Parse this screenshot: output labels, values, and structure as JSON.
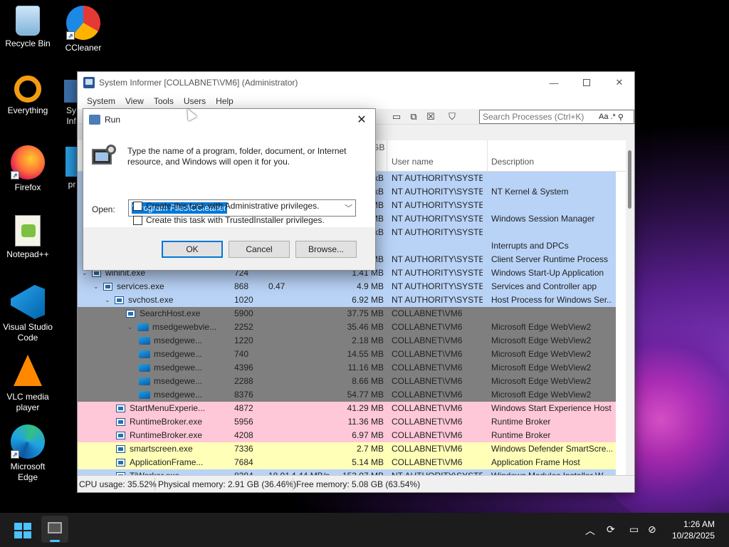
{
  "desktop": {
    "icons": [
      {
        "label": "Recycle Bin",
        "icon": "recycle-bin-icon"
      },
      {
        "label": "CCleaner",
        "icon": "ccleaner-icon"
      },
      {
        "label": "Everything",
        "icon": "everything-icon"
      },
      {
        "label": "Firefox",
        "icon": "firefox-icon"
      },
      {
        "label": "Notepad++",
        "icon": "notepadpp-icon"
      },
      {
        "label": "Visual Studio Code",
        "icon": "vscode-icon"
      },
      {
        "label": "VLC media player",
        "icon": "vlc-icon"
      },
      {
        "label": "Microsoft Edge",
        "icon": "edge-icon"
      }
    ],
    "partial_labels": [
      "Sy",
      "Inf",
      "pr"
    ]
  },
  "si": {
    "title": "System Informer [COLLABNET\\VM6] (Administrator)",
    "menu": [
      "System",
      "View",
      "Tools",
      "Users",
      "Help"
    ],
    "search_placeholder": "Search Processes (Ctrl+K)",
    "search_opts": "Aa",
    "search_regex": ".*",
    "header_partial": "GB",
    "columns": {
      "user": "User name",
      "desc": "Description"
    },
    "rows": [
      {
        "name": "",
        "pid": "",
        "cpu": "",
        "mem": "kB",
        "user": "NT AUTHORITY\\SYSTEM",
        "desc": ""
      },
      {
        "name": "",
        "pid": "",
        "cpu": "",
        "mem": "kB",
        "user": "NT AUTHORITY\\SYSTEM",
        "desc": "NT Kernel & System"
      },
      {
        "name": "",
        "pid": "",
        "cpu": "",
        "mem": "MB",
        "user": "NT AUTHORITY\\SYSTEM",
        "desc": ""
      },
      {
        "name": "",
        "pid": "",
        "cpu": "",
        "mem": "MB",
        "user": "NT AUTHORITY\\SYSTEM",
        "desc": "Windows Session Manager"
      },
      {
        "name": "",
        "pid": "",
        "cpu": "",
        "mem": "kB",
        "user": "NT AUTHORITY\\SYSTEM",
        "desc": ""
      },
      {
        "name": "",
        "pid": "",
        "cpu": "",
        "mem": "",
        "user": "",
        "desc": "Interrupts and DPCs"
      },
      {
        "name": "",
        "pid": "",
        "cpu": "",
        "mem": "MB",
        "user": "NT AUTHORITY\\SYSTEM",
        "desc": "Client Server Runtime Process"
      },
      {
        "name": "wininit.exe",
        "pid": "724",
        "cpu": "",
        "mem": "1.41 MB",
        "user": "NT AUTHORITY\\SYSTEM",
        "desc": "Windows Start-Up Application"
      },
      {
        "name": "services.exe",
        "pid": "868",
        "cpu": "0.47",
        "mem": "4.9 MB",
        "user": "NT AUTHORITY\\SYSTEM",
        "desc": "Services and Controller app"
      },
      {
        "name": "svchost.exe",
        "pid": "1020",
        "cpu": "",
        "mem": "6.92 MB",
        "user": "NT AUTHORITY\\SYSTEM",
        "desc": "Host Process for Windows Ser..."
      },
      {
        "name": "SearchHost.exe",
        "pid": "5900",
        "cpu": "",
        "mem": "37.75 MB",
        "user": "COLLABNET\\VM6",
        "desc": ""
      },
      {
        "name": "msedgewebvie...",
        "pid": "2252",
        "cpu": "",
        "mem": "35.46 MB",
        "user": "COLLABNET\\VM6",
        "desc": "Microsoft Edge WebView2"
      },
      {
        "name": "msedgewe...",
        "pid": "1220",
        "cpu": "",
        "mem": "2.18 MB",
        "user": "COLLABNET\\VM6",
        "desc": "Microsoft Edge WebView2"
      },
      {
        "name": "msedgewe...",
        "pid": "740",
        "cpu": "",
        "mem": "14.55 MB",
        "user": "COLLABNET\\VM6",
        "desc": "Microsoft Edge WebView2"
      },
      {
        "name": "msedgewe...",
        "pid": "4396",
        "cpu": "",
        "mem": "11.16 MB",
        "user": "COLLABNET\\VM6",
        "desc": "Microsoft Edge WebView2"
      },
      {
        "name": "msedgewe...",
        "pid": "2288",
        "cpu": "",
        "mem": "8.66 MB",
        "user": "COLLABNET\\VM6",
        "desc": "Microsoft Edge WebView2"
      },
      {
        "name": "msedgewe...",
        "pid": "8376",
        "cpu": "",
        "mem": "54.77 MB",
        "user": "COLLABNET\\VM6",
        "desc": "Microsoft Edge WebView2"
      },
      {
        "name": "StartMenuExperie...",
        "pid": "4872",
        "cpu": "",
        "mem": "41.29 MB",
        "user": "COLLABNET\\VM6",
        "desc": "Windows Start Experience Host"
      },
      {
        "name": "RuntimeBroker.exe",
        "pid": "5956",
        "cpu": "",
        "mem": "11.36 MB",
        "user": "COLLABNET\\VM6",
        "desc": "Runtime Broker"
      },
      {
        "name": "RuntimeBroker.exe",
        "pid": "4208",
        "cpu": "",
        "mem": "6.97 MB",
        "user": "COLLABNET\\VM6",
        "desc": "Runtime Broker"
      },
      {
        "name": "smartscreen.exe",
        "pid": "7336",
        "cpu": "",
        "mem": "2.7 MB",
        "user": "COLLABNET\\VM6",
        "desc": "Windows Defender SmartScre..."
      },
      {
        "name": "ApplicationFrame...",
        "pid": "7684",
        "cpu": "",
        "mem": "5.14 MB",
        "user": "COLLABNET\\VM6",
        "desc": "Application Frame Host"
      },
      {
        "name": "TiWorker.exe",
        "pid": "8384",
        "cpu": "18.91",
        "mem": "153.07 MB",
        "user": "NT AUTHORITY\\SYSTEM",
        "desc": "Windows Modules Installer W...",
        "io": "4.44 MB/s"
      }
    ],
    "status": {
      "cpu": "CPU usage: 35.52%",
      "phys": "Physical memory: 2.91 GB (36.46%)",
      "free": "Free memory: 5.08 GB (63.54%)"
    },
    "colors": {
      "system": "#b9d3f7",
      "service_dim": "#7f7f7f",
      "user_pink": "#ffc8d8",
      "immersive_yellow": "#ffffb8"
    }
  },
  "run": {
    "title": "Run",
    "description": "Type the name of a program, folder, document, or Internet resource, and Windows will open it for you.",
    "open_label": "Open:",
    "open_value": "\\Program Files\\CCleaner",
    "chk_admin": "Create this task with Administrative privileges.",
    "chk_trusted": "Create this task with TrustedInstaller privileges.",
    "ok": "OK",
    "cancel": "Cancel",
    "browse": "Browse..."
  },
  "taskbar": {
    "time": "1:26 AM",
    "date": "10/28/2025"
  }
}
